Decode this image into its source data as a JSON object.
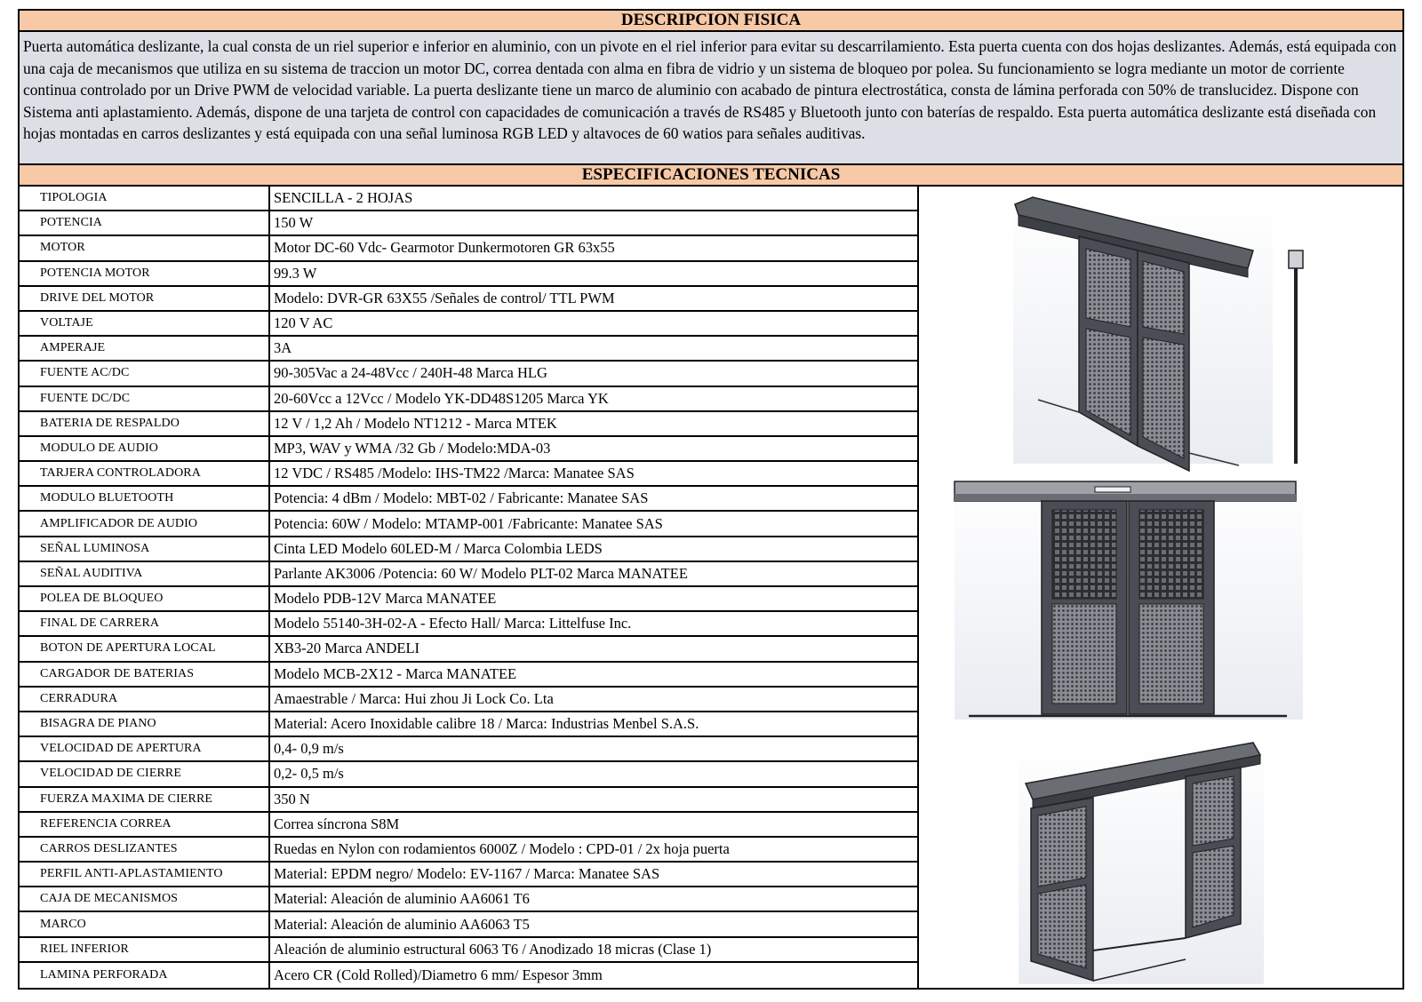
{
  "description": {
    "title": "DESCRIPCION FISICA",
    "text": "Puerta automática deslizante, la cual consta de un riel superior e inferior en aluminio, con un pivote en el riel inferior para evitar su descarrilamiento. Esta puerta cuenta con dos hojas deslizantes. Además, está equipada con una caja de mecanismos que utiliza en su sistema de traccion un motor DC, correa dentada con alma en fibra de vidrio y un sistema de bloqueo por polea. Su funcionamiento se logra mediante un motor de corriente continua controlado por un Drive PWM de velocidad variable. La puerta deslizante tiene un marco de aluminio con acabado de pintura electrostática, consta de lámina perforada con 50% de translucidez. Dispone con Sistema anti aplastamiento.  Además, dispone de una tarjeta de control con capacidades de comunicación a través de RS485 y Bluetooth junto con baterías de respaldo. Esta puerta automática deslizante está diseñada con hojas montadas en carros deslizantes y está equipada con una señal luminosa RGB LED y altavoces de 60 watios para señales auditivas."
  },
  "specs": {
    "title": "ESPECIFICACIONES TECNICAS",
    "rows": [
      {
        "key": "TIPOLOGIA",
        "value": "SENCILLA - 2 HOJAS"
      },
      {
        "key": "POTENCIA",
        "value": "150 W"
      },
      {
        "key": "MOTOR",
        "value": "Motor DC-60 Vdc- Gearmotor Dunkermotoren GR 63x55"
      },
      {
        "key": "POTENCIA MOTOR",
        "value": "99.3 W"
      },
      {
        "key": "DRIVE DEL MOTOR",
        "value": "Modelo: DVR-GR 63X55 /Señales de control/ TTL PWM"
      },
      {
        "key": "VOLTAJE",
        "value": "120 V AC"
      },
      {
        "key": "AMPERAJE",
        "value": "3A"
      },
      {
        "key": "FUENTE AC/DC",
        "value": " 90-305Vac a 24-48Vcc / 240H-48  Marca HLG"
      },
      {
        "key": "FUENTE DC/DC",
        "value": " 20-60Vcc a 12Vcc / Modelo YK-DD48S1205 Marca YK"
      },
      {
        "key": "BATERIA DE RESPALDO",
        "value": "12 V / 1,2 Ah / Modelo NT1212 - Marca MTEK"
      },
      {
        "key": "MODULO DE AUDIO",
        "value": "MP3, WAV y WMA /32 Gb / Modelo:MDA-03"
      },
      {
        "key": "TARJERA CONTROLADORA",
        "value": "12 VDC / RS485 /Modelo: IHS-TM22 /Marca: Manatee SAS"
      },
      {
        "key": "MODULO BLUETOOTH",
        "value": "Potencia: 4 dBm / Modelo: MBT-02 / Fabricante: Manatee SAS"
      },
      {
        "key": "AMPLIFICADOR DE AUDIO",
        "value": "Potencia: 60W / Modelo: MTAMP-001 /Fabricante: Manatee SAS"
      },
      {
        "key": "SEÑAL LUMINOSA",
        "value": "Cinta LED Modelo 60LED-M / Marca Colombia LEDS"
      },
      {
        "key": "SEÑAL AUDITIVA",
        "value": "Parlante AK3006 /Potencia: 60 W/  Modelo PLT-02 Marca MANATEE"
      },
      {
        "key": "POLEA DE BLOQUEO",
        "value": "Modelo PDB-12V Marca MANATEE"
      },
      {
        "key": "FINAL DE CARRERA",
        "value": "Modelo 55140-3H-02-A - Efecto Hall/ Marca: Littelfuse Inc."
      },
      {
        "key": "BOTON DE APERTURA LOCAL",
        "value": "XB3-20 Marca ANDELI"
      },
      {
        "key": "CARGADOR DE BATERIAS",
        "value": "Modelo MCB-2X12 - Marca MANATEE"
      },
      {
        "key": "CERRADURA",
        "value": "Amaestrable / Marca: Hui zhou Ji Lock Co. Lta"
      },
      {
        "key": "BISAGRA DE PIANO",
        "value": "Material: Acero Inoxidable calibre 18 / Marca: Industrias Menbel S.A.S."
      },
      {
        "key": "VELOCIDAD DE APERTURA",
        "value": "0,4- 0,9 m/s"
      },
      {
        "key": "VELOCIDAD DE CIERRE",
        "value": "0,2- 0,5 m/s"
      },
      {
        "key": "FUERZA MAXIMA DE CIERRE",
        "value": "350 N"
      },
      {
        "key": "REFERENCIA CORREA",
        "value": "Correa síncrona S8M"
      },
      {
        "key": "CARROS DESLIZANTES",
        "value": "Ruedas en Nylon con rodamientos 6000Z / Modelo : CPD-01 / 2x hoja puerta"
      },
      {
        "key": "PERFIL ANTI-APLASTAMIENTO",
        "value": "Material: EPDM negro/ Modelo:  EV-1167 / Marca: Manatee SAS"
      },
      {
        "key": "CAJA DE MECANISMOS",
        "value": "Material: Aleación de aluminio AA6061 T6"
      },
      {
        "key": "MARCO",
        "value": "Material: Aleación de aluminio AA6063 T5"
      },
      {
        "key": "RIEL INFERIOR",
        "value": "Aleación de aluminio estructural 6063 T6 / Anodizado 18 micras (Clase 1)"
      },
      {
        "key": "LAMINA PERFORADA",
        "value": "Acero CR (Cold Rolled)/Diametro 6 mm/ Espesor 3mm"
      }
    ]
  },
  "colors": {
    "header_band": "#f7c9a7",
    "description_bg": "#dcdfe6",
    "door_frame": "#4a4d55",
    "mesh": "#6b6e75"
  }
}
